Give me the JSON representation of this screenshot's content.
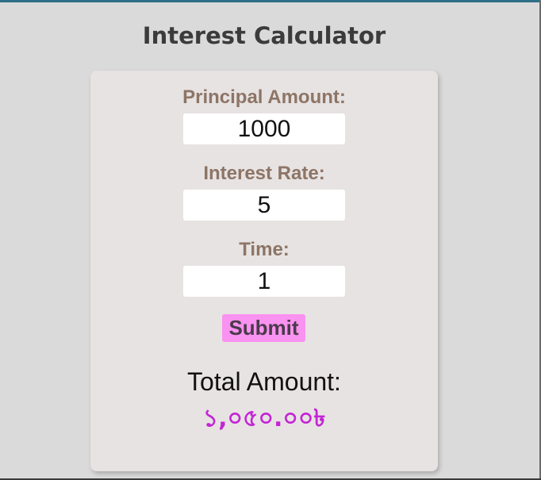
{
  "page": {
    "title": "Interest Calculator"
  },
  "form": {
    "principal": {
      "label": "Principal Amount:",
      "value": "1000"
    },
    "rate": {
      "label": "Interest Rate:",
      "value": "5"
    },
    "time": {
      "label": "Time:",
      "value": "1"
    },
    "submit_label": "Submit"
  },
  "result": {
    "label": "Total Amount:",
    "value": "১,০৫০.০০৳"
  },
  "colors": {
    "background": "#dadada",
    "card": "#e7e3e2",
    "label": "#8d7566",
    "button": "#f992f0",
    "result_value": "#c424d6",
    "title": "#3b3b3b"
  }
}
